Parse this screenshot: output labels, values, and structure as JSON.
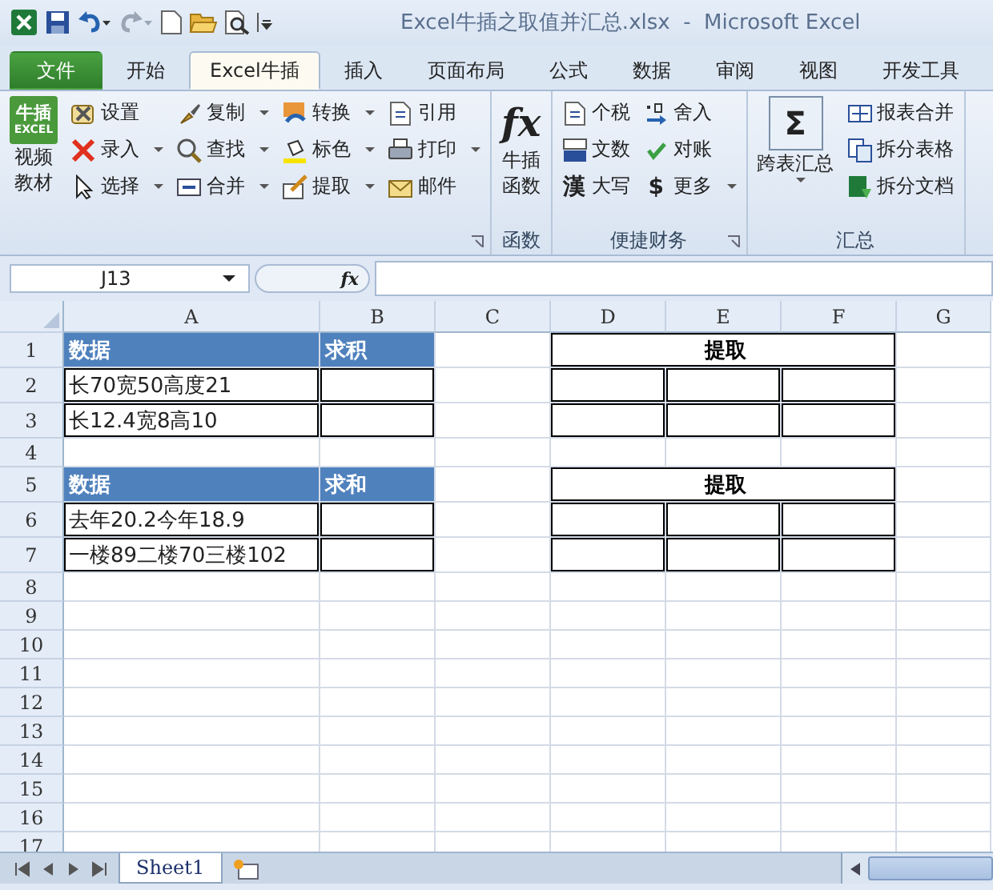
{
  "window": {
    "title": "Excel牛插之取值并汇总.xlsx  -  Microsoft Excel"
  },
  "tabs": [
    {
      "label": "文件",
      "kind": "file",
      "selected": false
    },
    {
      "label": "开始",
      "kind": "tab",
      "selected": false
    },
    {
      "label": "Excel牛插",
      "kind": "tab",
      "selected": true
    },
    {
      "label": "插入",
      "kind": "tab",
      "selected": false
    },
    {
      "label": "页面布局",
      "kind": "tab",
      "selected": false
    },
    {
      "label": "公式",
      "kind": "tab",
      "selected": false
    },
    {
      "label": "数据",
      "kind": "tab",
      "selected": false
    },
    {
      "label": "审阅",
      "kind": "tab",
      "selected": false
    },
    {
      "label": "视图",
      "kind": "tab",
      "selected": false
    },
    {
      "label": "开发工具",
      "kind": "tab",
      "selected": false
    }
  ],
  "ribbon": {
    "groups": [
      {
        "big": {
          "logo": [
            "牛插",
            "EXCEL"
          ],
          "label": [
            "视频",
            "教材"
          ],
          "dropdown": false
        },
        "columns": [
          [
            {
              "label": "设置",
              "dropdown": false
            },
            {
              "label": "录入",
              "dropdown": true
            },
            {
              "label": "选择",
              "dropdown": true
            }
          ],
          [
            {
              "label": "复制",
              "dropdown": true
            },
            {
              "label": "查找",
              "dropdown": true
            },
            {
              "label": "合并",
              "dropdown": true
            }
          ],
          [
            {
              "label": "转换",
              "dropdown": true
            },
            {
              "label": "标色",
              "dropdown": true
            },
            {
              "label": "提取",
              "dropdown": true
            }
          ],
          [
            {
              "label": "引用",
              "dropdown": false
            },
            {
              "label": "打印",
              "dropdown": true
            },
            {
              "label": "邮件",
              "dropdown": false
            }
          ]
        ],
        "launcher": true
      },
      {
        "big": {
          "glyph": "fx",
          "label": [
            "牛插",
            "函数"
          ],
          "dropdown": false
        },
        "label": "函数"
      },
      {
        "columns": [
          [
            {
              "label": "个税",
              "dropdown": false
            },
            {
              "label": "文数",
              "dropdown": false
            },
            {
              "label": "大写",
              "glyph": "漢",
              "dropdown": false
            }
          ],
          [
            {
              "label": "舍入",
              "dropdown": false
            },
            {
              "label": "对账",
              "dropdown": false
            },
            {
              "label": "更多",
              "glyph": "$",
              "dropdown": true
            }
          ]
        ],
        "label": "便捷财务",
        "launcher": true
      },
      {
        "big": {
          "glyph": "Σ",
          "label": [
            "跨表汇总"
          ],
          "dropdown": true
        },
        "columns": [
          [
            {
              "label": "报表合并",
              "dropdown": false
            },
            {
              "label": "拆分表格",
              "dropdown": false
            },
            {
              "label": "拆分文档",
              "dropdown": false
            }
          ]
        ],
        "label": "汇总"
      }
    ]
  },
  "formula_bar": {
    "name_box": "J13",
    "fx": "fx"
  },
  "columns": [
    "A",
    "B",
    "C",
    "D",
    "E",
    "F",
    "G"
  ],
  "rows": [
    {
      "header": "1",
      "cells": [
        {
          "kind": "header",
          "text": "数据"
        },
        {
          "kind": "header",
          "text": "求积"
        },
        {
          "kind": "plain"
        },
        {
          "kind": "merged_title",
          "text": "提取"
        },
        {
          "kind": "plain"
        }
      ]
    },
    {
      "header": "2",
      "cells": [
        {
          "kind": "boxed",
          "text": "长70宽50高度21"
        },
        {
          "kind": "boxed"
        },
        {
          "kind": "plain"
        },
        {
          "kind": "boxed"
        },
        {
          "kind": "boxed"
        },
        {
          "kind": "boxed"
        },
        {
          "kind": "plain"
        }
      ]
    },
    {
      "header": "3",
      "cells": [
        {
          "kind": "boxed",
          "text": "长12.4宽8高10"
        },
        {
          "kind": "boxed"
        },
        {
          "kind": "plain"
        },
        {
          "kind": "boxed"
        },
        {
          "kind": "boxed"
        },
        {
          "kind": "boxed"
        },
        {
          "kind": "plain"
        }
      ]
    },
    {
      "header": "4"
    },
    {
      "header": "5",
      "cells": [
        {
          "kind": "header",
          "text": "数据"
        },
        {
          "kind": "header",
          "text": "求和"
        },
        {
          "kind": "plain"
        },
        {
          "kind": "merged_title",
          "text": "提取"
        },
        {
          "kind": "plain"
        }
      ]
    },
    {
      "header": "6",
      "cells": [
        {
          "kind": "boxed",
          "text": "去年20.2今年18.9"
        },
        {
          "kind": "boxed"
        },
        {
          "kind": "plain"
        },
        {
          "kind": "boxed"
        },
        {
          "kind": "boxed"
        },
        {
          "kind": "boxed"
        },
        {
          "kind": "plain"
        }
      ]
    },
    {
      "header": "7",
      "cells": [
        {
          "kind": "boxed",
          "text": "一楼89二楼70三楼102"
        },
        {
          "kind": "boxed"
        },
        {
          "kind": "plain"
        },
        {
          "kind": "boxed"
        },
        {
          "kind": "boxed"
        },
        {
          "kind": "boxed"
        },
        {
          "kind": "plain"
        }
      ]
    },
    {
      "header": "8"
    },
    {
      "header": "9"
    },
    {
      "header": "10"
    },
    {
      "header": "11"
    },
    {
      "header": "12"
    },
    {
      "header": "13"
    },
    {
      "header": "14"
    },
    {
      "header": "15"
    },
    {
      "header": "16"
    },
    {
      "header": "17"
    }
  ],
  "sheet_tabs": [
    {
      "label": "Sheet1",
      "selected": true
    }
  ]
}
